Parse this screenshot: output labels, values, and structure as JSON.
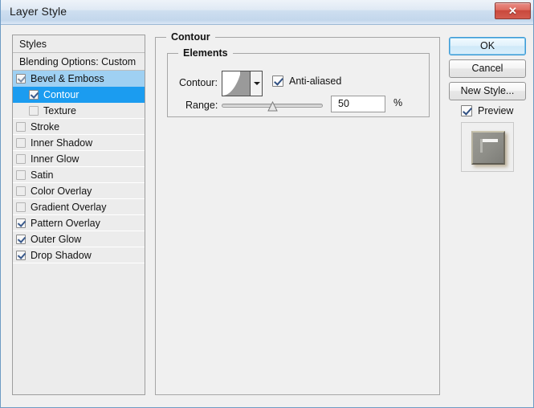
{
  "window": {
    "title": "Layer Style",
    "close_label": "✕"
  },
  "styles_panel": {
    "header_label": "Styles",
    "blending_label": "Blending Options: Custom",
    "items": [
      {
        "label": "Bevel & Emboss",
        "checked": true,
        "level": 0,
        "state": "highlight"
      },
      {
        "label": "Contour",
        "checked": true,
        "level": 1,
        "state": "selected"
      },
      {
        "label": "Texture",
        "checked": false,
        "level": 1,
        "state": "normal"
      },
      {
        "label": "Stroke",
        "checked": false,
        "level": 0,
        "state": "normal"
      },
      {
        "label": "Inner Shadow",
        "checked": false,
        "level": 0,
        "state": "normal"
      },
      {
        "label": "Inner Glow",
        "checked": false,
        "level": 0,
        "state": "normal"
      },
      {
        "label": "Satin",
        "checked": false,
        "level": 0,
        "state": "normal"
      },
      {
        "label": "Color Overlay",
        "checked": false,
        "level": 0,
        "state": "normal"
      },
      {
        "label": "Gradient Overlay",
        "checked": false,
        "level": 0,
        "state": "normal"
      },
      {
        "label": "Pattern Overlay",
        "checked": true,
        "level": 0,
        "state": "normal"
      },
      {
        "label": "Outer Glow",
        "checked": true,
        "level": 0,
        "state": "normal"
      },
      {
        "label": "Drop Shadow",
        "checked": true,
        "level": 0,
        "state": "normal"
      }
    ]
  },
  "contour_group": {
    "title": "Contour",
    "elements_group": {
      "title": "Elements",
      "contour_label": "Contour:",
      "anti_aliased_label": "Anti-aliased",
      "anti_aliased_checked": true,
      "range_label": "Range:",
      "range_value": "50",
      "range_percent_sign": "%",
      "range_slider_position": 50
    }
  },
  "buttons": {
    "ok": "OK",
    "cancel": "Cancel",
    "new_style": "New Style...",
    "preview_label": "Preview",
    "preview_checked": true
  },
  "colors": {
    "titlebar_gradient_top": "#eef3f9",
    "titlebar_gradient_bottom": "#c3d7ec",
    "dialog_background": "#f0f0f0",
    "list_background": "#ececec",
    "selection_strong": "#1b9cf0",
    "selection_light": "#9fd0f2",
    "close_button": "#c9483c",
    "default_button_border": "#3c9ad6",
    "group_border": "#a6a6a6"
  }
}
